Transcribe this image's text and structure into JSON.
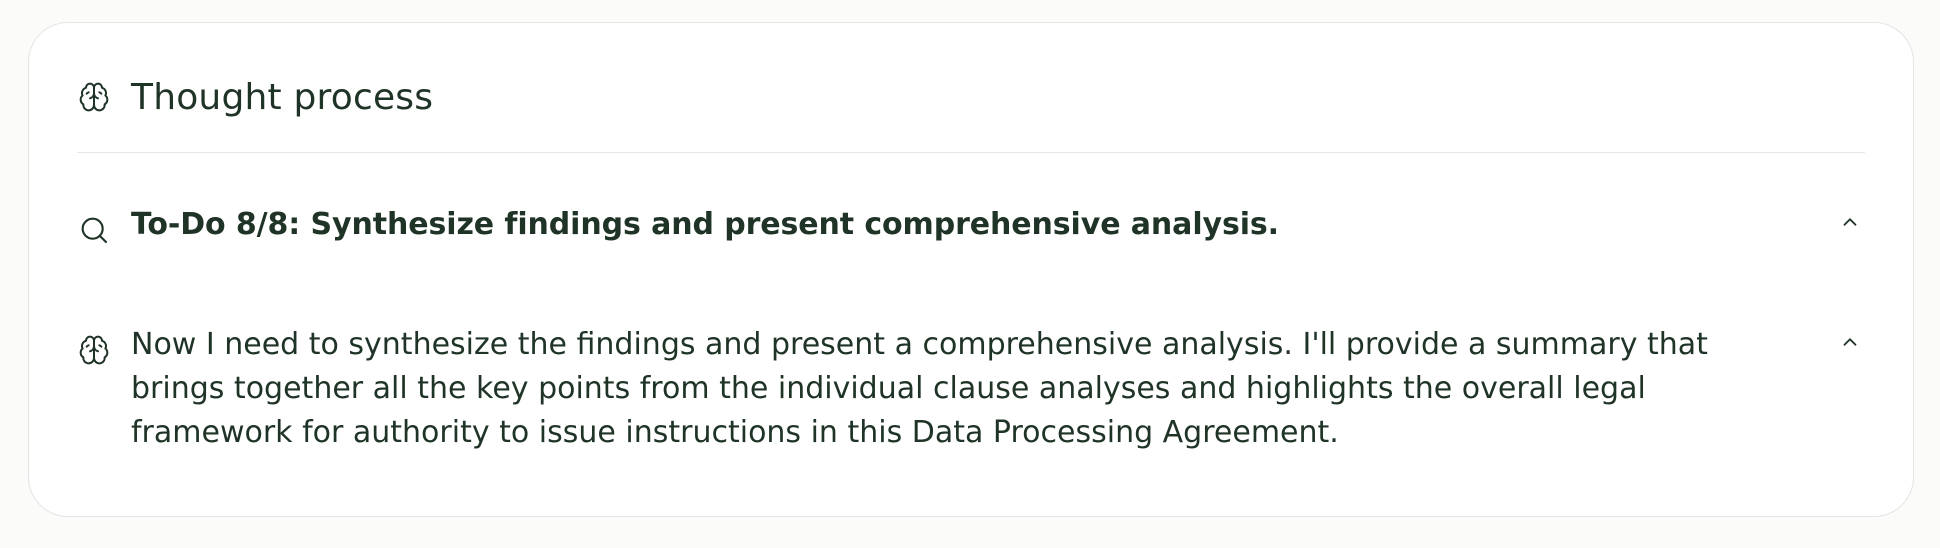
{
  "header": {
    "title": "Thought process",
    "icon": "brain-icon"
  },
  "steps": [
    {
      "icon": "search-icon",
      "text": "To-Do 8/8: Synthesize findings and present comprehensive analysis.",
      "expanded": true,
      "toggle_icon": "chevron-up-icon"
    },
    {
      "icon": "brain-icon",
      "text": "Now I need to synthesize the findings and present a comprehensive analysis. I'll provide a summary that brings together all the key points from the individual clause analyses and highlights the overall legal framework for authority to issue instructions in this Data Processing Agreement.",
      "expanded": true,
      "toggle_icon": "chevron-up-icon"
    }
  ],
  "colors": {
    "text": "#1f3326",
    "border": "#e3e5e3",
    "background": "#ffffff"
  }
}
